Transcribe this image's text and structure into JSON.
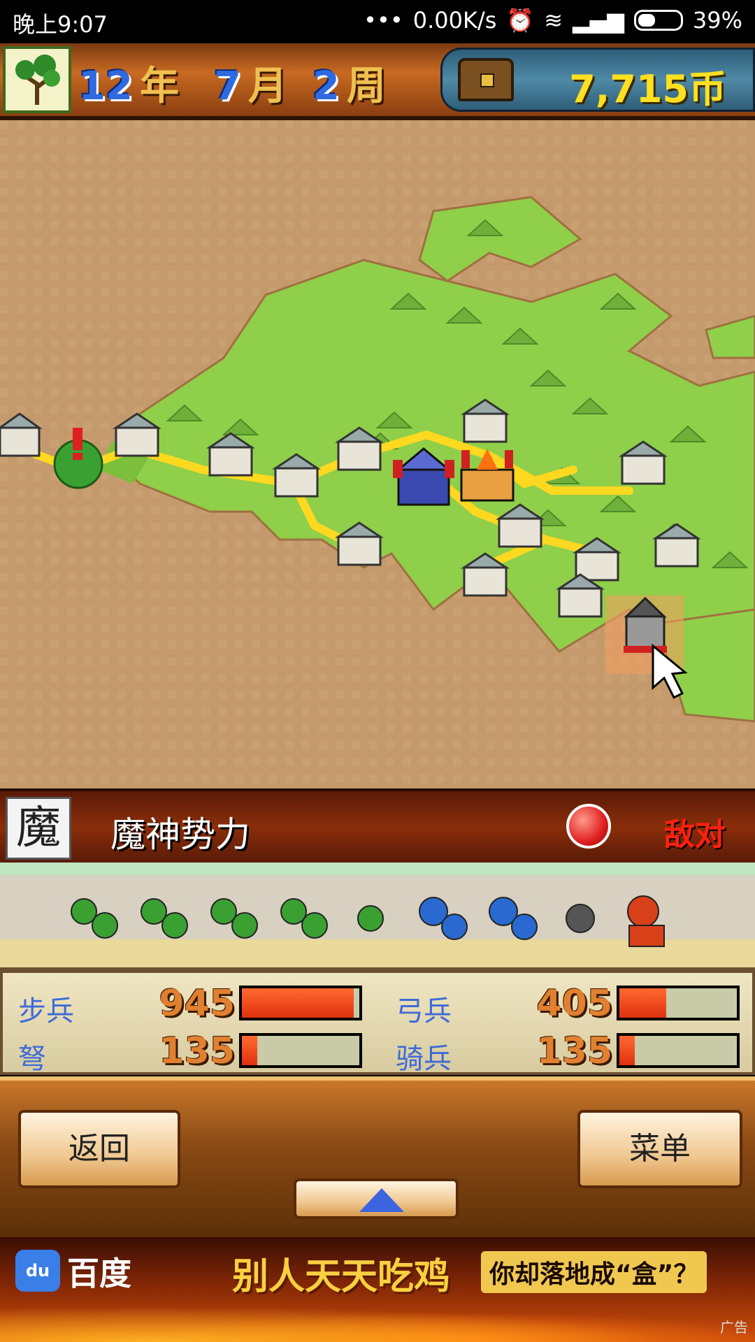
{
  "statusbar": {
    "time": "晚上9:07",
    "speed": "0.00K/s",
    "signal_dots": "•••",
    "battery": "39%"
  },
  "header": {
    "year_num": "12",
    "year_unit": "年",
    "month_num": "7",
    "month_unit": "月",
    "week_num": "2",
    "week_unit": "周",
    "coins": "7,715币"
  },
  "faction": {
    "icon_char": "魔",
    "name": "魔神势力",
    "status": "敌对"
  },
  "stats": [
    {
      "label": "步兵",
      "value": "945",
      "fill": 0.95
    },
    {
      "label": "弓兵",
      "value": "405",
      "fill": 0.4
    },
    {
      "label": "弩",
      "value": "135",
      "fill": 0.13
    },
    {
      "label": "骑兵",
      "value": "135",
      "fill": 0.13
    }
  ],
  "buttons": {
    "back": "返回",
    "menu": "菜单"
  },
  "ad": {
    "brand": "百度",
    "logo": "du",
    "slogan1": "别人天天吃鸡",
    "slogan2": "你却落地成“盒”？",
    "tag": "广告"
  },
  "colors": {
    "grass": "#8fcf4a",
    "sand": "#c49a6c",
    "road": "#ffd820",
    "accent_blue": "#3f6ad8"
  }
}
